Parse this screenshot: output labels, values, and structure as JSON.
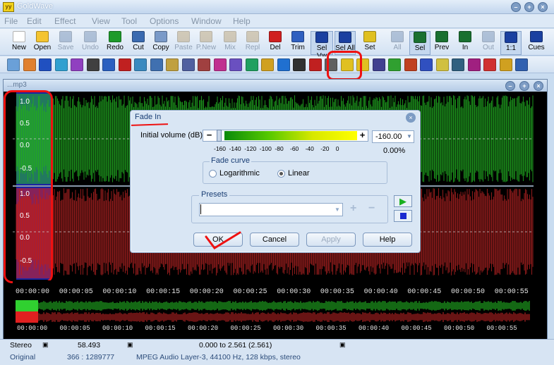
{
  "window": {
    "title": "GoldWave"
  },
  "menu": [
    "File",
    "Edit",
    "Effect",
    "View",
    "Tool",
    "Options",
    "Window",
    "Help"
  ],
  "toolbar": [
    {
      "label": "New",
      "icon": "new-file-icon",
      "color": "#ffffff",
      "disabled": false
    },
    {
      "label": "Open",
      "icon": "open-folder-icon",
      "color": "#f4c430",
      "disabled": false
    },
    {
      "label": "Save",
      "icon": "save-icon",
      "color": "#6a88b0",
      "disabled": true
    },
    {
      "label": "Undo",
      "icon": "undo-icon",
      "color": "#6a88b0",
      "disabled": true
    },
    {
      "label": "Redo",
      "icon": "redo-icon",
      "color": "#1e9a2a",
      "disabled": false
    },
    {
      "label": "Cut",
      "icon": "scissors-icon",
      "color": "#3a6ab0",
      "disabled": false
    },
    {
      "label": "Copy",
      "icon": "copy-icon",
      "color": "#7a9ac8",
      "disabled": false
    },
    {
      "label": "Paste",
      "icon": "paste-icon",
      "color": "#b49a6a",
      "disabled": true
    },
    {
      "label": "P.New",
      "icon": "paste-new-icon",
      "color": "#b49a6a",
      "disabled": true
    },
    {
      "label": "Mix",
      "icon": "mix-icon",
      "color": "#b49a6a",
      "disabled": true
    },
    {
      "label": "Repl",
      "icon": "replace-icon",
      "color": "#b49a6a",
      "disabled": true
    },
    {
      "label": "Del",
      "icon": "delete-icon",
      "color": "#d02020",
      "disabled": false
    },
    {
      "label": "Trim",
      "icon": "trim-icon",
      "color": "#3060c0",
      "disabled": false
    },
    {
      "label": "Sel Vw",
      "icon": "select-view-icon",
      "color": "#1a40a0",
      "disabled": false
    },
    {
      "label": "Sel All",
      "icon": "select-all-icon",
      "color": "#1a40a0",
      "disabled": false
    },
    {
      "label": "Set",
      "icon": "set-icon",
      "color": "#e0c020",
      "disabled": false
    },
    {
      "label": "All",
      "icon": "zoom-all-icon",
      "color": "#6a88b0",
      "disabled": true
    },
    {
      "label": "Sel",
      "icon": "zoom-selection-icon",
      "color": "#1a7030",
      "disabled": false
    },
    {
      "label": "Prev",
      "icon": "zoom-previous-icon",
      "color": "#1a7030",
      "disabled": false
    },
    {
      "label": "In",
      "icon": "zoom-in-icon",
      "color": "#1a7030",
      "disabled": false
    },
    {
      "label": "Out",
      "icon": "zoom-out-icon",
      "color": "#6a88b0",
      "disabled": true
    },
    {
      "label": "1:1",
      "icon": "zoom-1to1-icon",
      "color": "#1a40a0",
      "disabled": false
    },
    {
      "label": "Cues",
      "icon": "cues-icon",
      "color": "#1a40a0",
      "disabled": false
    }
  ],
  "effects_toolbar_colors": [
    "#6aa0d8",
    "#e08030",
    "#2050c0",
    "#30a0d0",
    "#9040c0",
    "#404040",
    "#2a60c0",
    "#c02020",
    "#3a8ac0",
    "#4070b0",
    "#c0a040",
    "#5060a0",
    "#a04040",
    "#c03090",
    "#6a50c0",
    "#20a060",
    "#d0a020",
    "#2070d0",
    "#303030",
    "#c02020",
    "#606060",
    "#e0c020",
    "#e0c020",
    "#404090",
    "#30a030",
    "#c04020",
    "#3050c0",
    "#d0c040",
    "#306080",
    "#a02080",
    "#d03030",
    "#d0a020",
    "#3060b0"
  ],
  "wave": {
    "file": "...mp3",
    "top_ylabels": [
      "1.0",
      "0.5",
      "0.0",
      "-0.5"
    ],
    "bottom_ylabels": [
      "1.0",
      "0.5",
      "0.0",
      "-0.5"
    ],
    "left_channel_color": "#1a8a1a",
    "right_channel_color": "#8a1a1a",
    "selection_bg": "#1a24a0",
    "time_labels": [
      "00:00:00",
      "00:00:05",
      "00:00:10",
      "00:00:15",
      "00:00:20",
      "00:00:25",
      "00:00:30",
      "00:00:35",
      "00:00:40",
      "00:00:45",
      "00:00:50",
      "00:00:55"
    ]
  },
  "dialog": {
    "title": "Fade In",
    "initial_volume_label": "Initial volume (dB):",
    "scale_ticks": [
      "-160",
      "-140",
      "-120",
      "-100",
      "-80",
      "-60",
      "-40",
      "-20",
      "0"
    ],
    "volume_value": "-160.00",
    "volume_percent": "0.00%",
    "fade_curve_legend": "Fade curve",
    "fade_options": [
      "Logarithmic",
      "Linear"
    ],
    "selected_fade": "Linear",
    "presets_legend": "Presets",
    "preset_value": "",
    "buttons": {
      "ok": "OK",
      "cancel": "Cancel",
      "apply": "Apply",
      "help": "Help"
    }
  },
  "status": {
    "channels": "Stereo",
    "length": "58.493",
    "selection": "0.000 to 2.561 (2.561)",
    "mode": "Original",
    "ratio": "366 : 1289777",
    "format": "MPEG Audio Layer-3, 44100 Hz, 128 kbps, stereo"
  }
}
